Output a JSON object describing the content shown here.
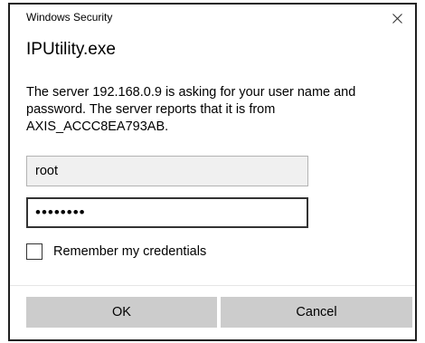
{
  "window": {
    "title": "Windows Security",
    "close_icon": "close-icon"
  },
  "dialog": {
    "app_name": "IPUtility.exe",
    "message": "The server 192.168.0.9 is asking for your user name and password. The server reports that it is from AXIS_ACCC8EA793AB.",
    "username": {
      "value": "root"
    },
    "password": {
      "masked_value": "••••••••"
    },
    "remember": {
      "label": "Remember my credentials",
      "checked": false
    },
    "buttons": {
      "ok": "OK",
      "cancel": "Cancel"
    }
  },
  "colors": {
    "button_bg": "#cccccc",
    "input_readonly_bg": "#f0f0f0",
    "border_dark": "#1f1f1f"
  }
}
